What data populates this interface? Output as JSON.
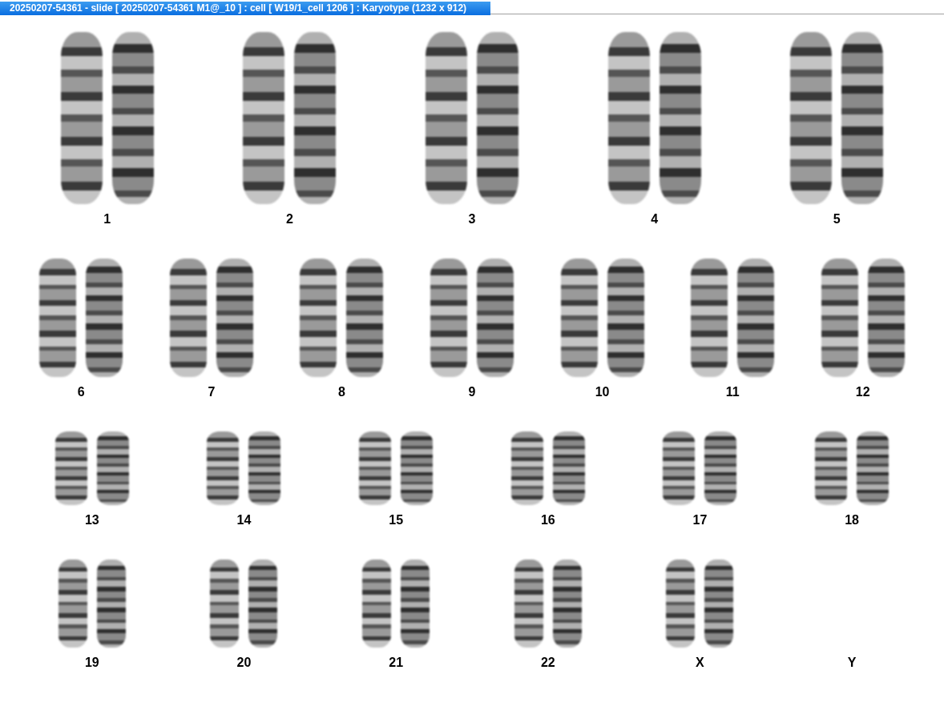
{
  "window": {
    "title": "20250207-54361 - slide [ 20250207-54361 M1@_10 ] : cell [ W19/1_cell 1206 ] : Karyotype  (1232 x 912)"
  },
  "karyotype": {
    "rows": [
      {
        "groups": [
          {
            "label": "1",
            "empty": false
          },
          {
            "label": "2",
            "empty": false
          },
          {
            "label": "3",
            "empty": false
          },
          {
            "label": "4",
            "empty": false
          },
          {
            "label": "5",
            "empty": false
          }
        ]
      },
      {
        "groups": [
          {
            "label": "6",
            "empty": false
          },
          {
            "label": "7",
            "empty": false
          },
          {
            "label": "8",
            "empty": false
          },
          {
            "label": "9",
            "empty": false
          },
          {
            "label": "10",
            "empty": false
          },
          {
            "label": "11",
            "empty": false
          },
          {
            "label": "12",
            "empty": false
          }
        ]
      },
      {
        "groups": [
          {
            "label": "13",
            "empty": false
          },
          {
            "label": "14",
            "empty": false
          },
          {
            "label": "15",
            "empty": false
          },
          {
            "label": "16",
            "empty": false
          },
          {
            "label": "17",
            "empty": false
          },
          {
            "label": "18",
            "empty": false
          }
        ]
      },
      {
        "groups": [
          {
            "label": "19",
            "empty": false
          },
          {
            "label": "20",
            "empty": false
          },
          {
            "label": "21",
            "empty": false
          },
          {
            "label": "22",
            "empty": false
          },
          {
            "label": "X",
            "empty": false
          },
          {
            "label": "Y",
            "empty": true
          }
        ]
      }
    ]
  }
}
